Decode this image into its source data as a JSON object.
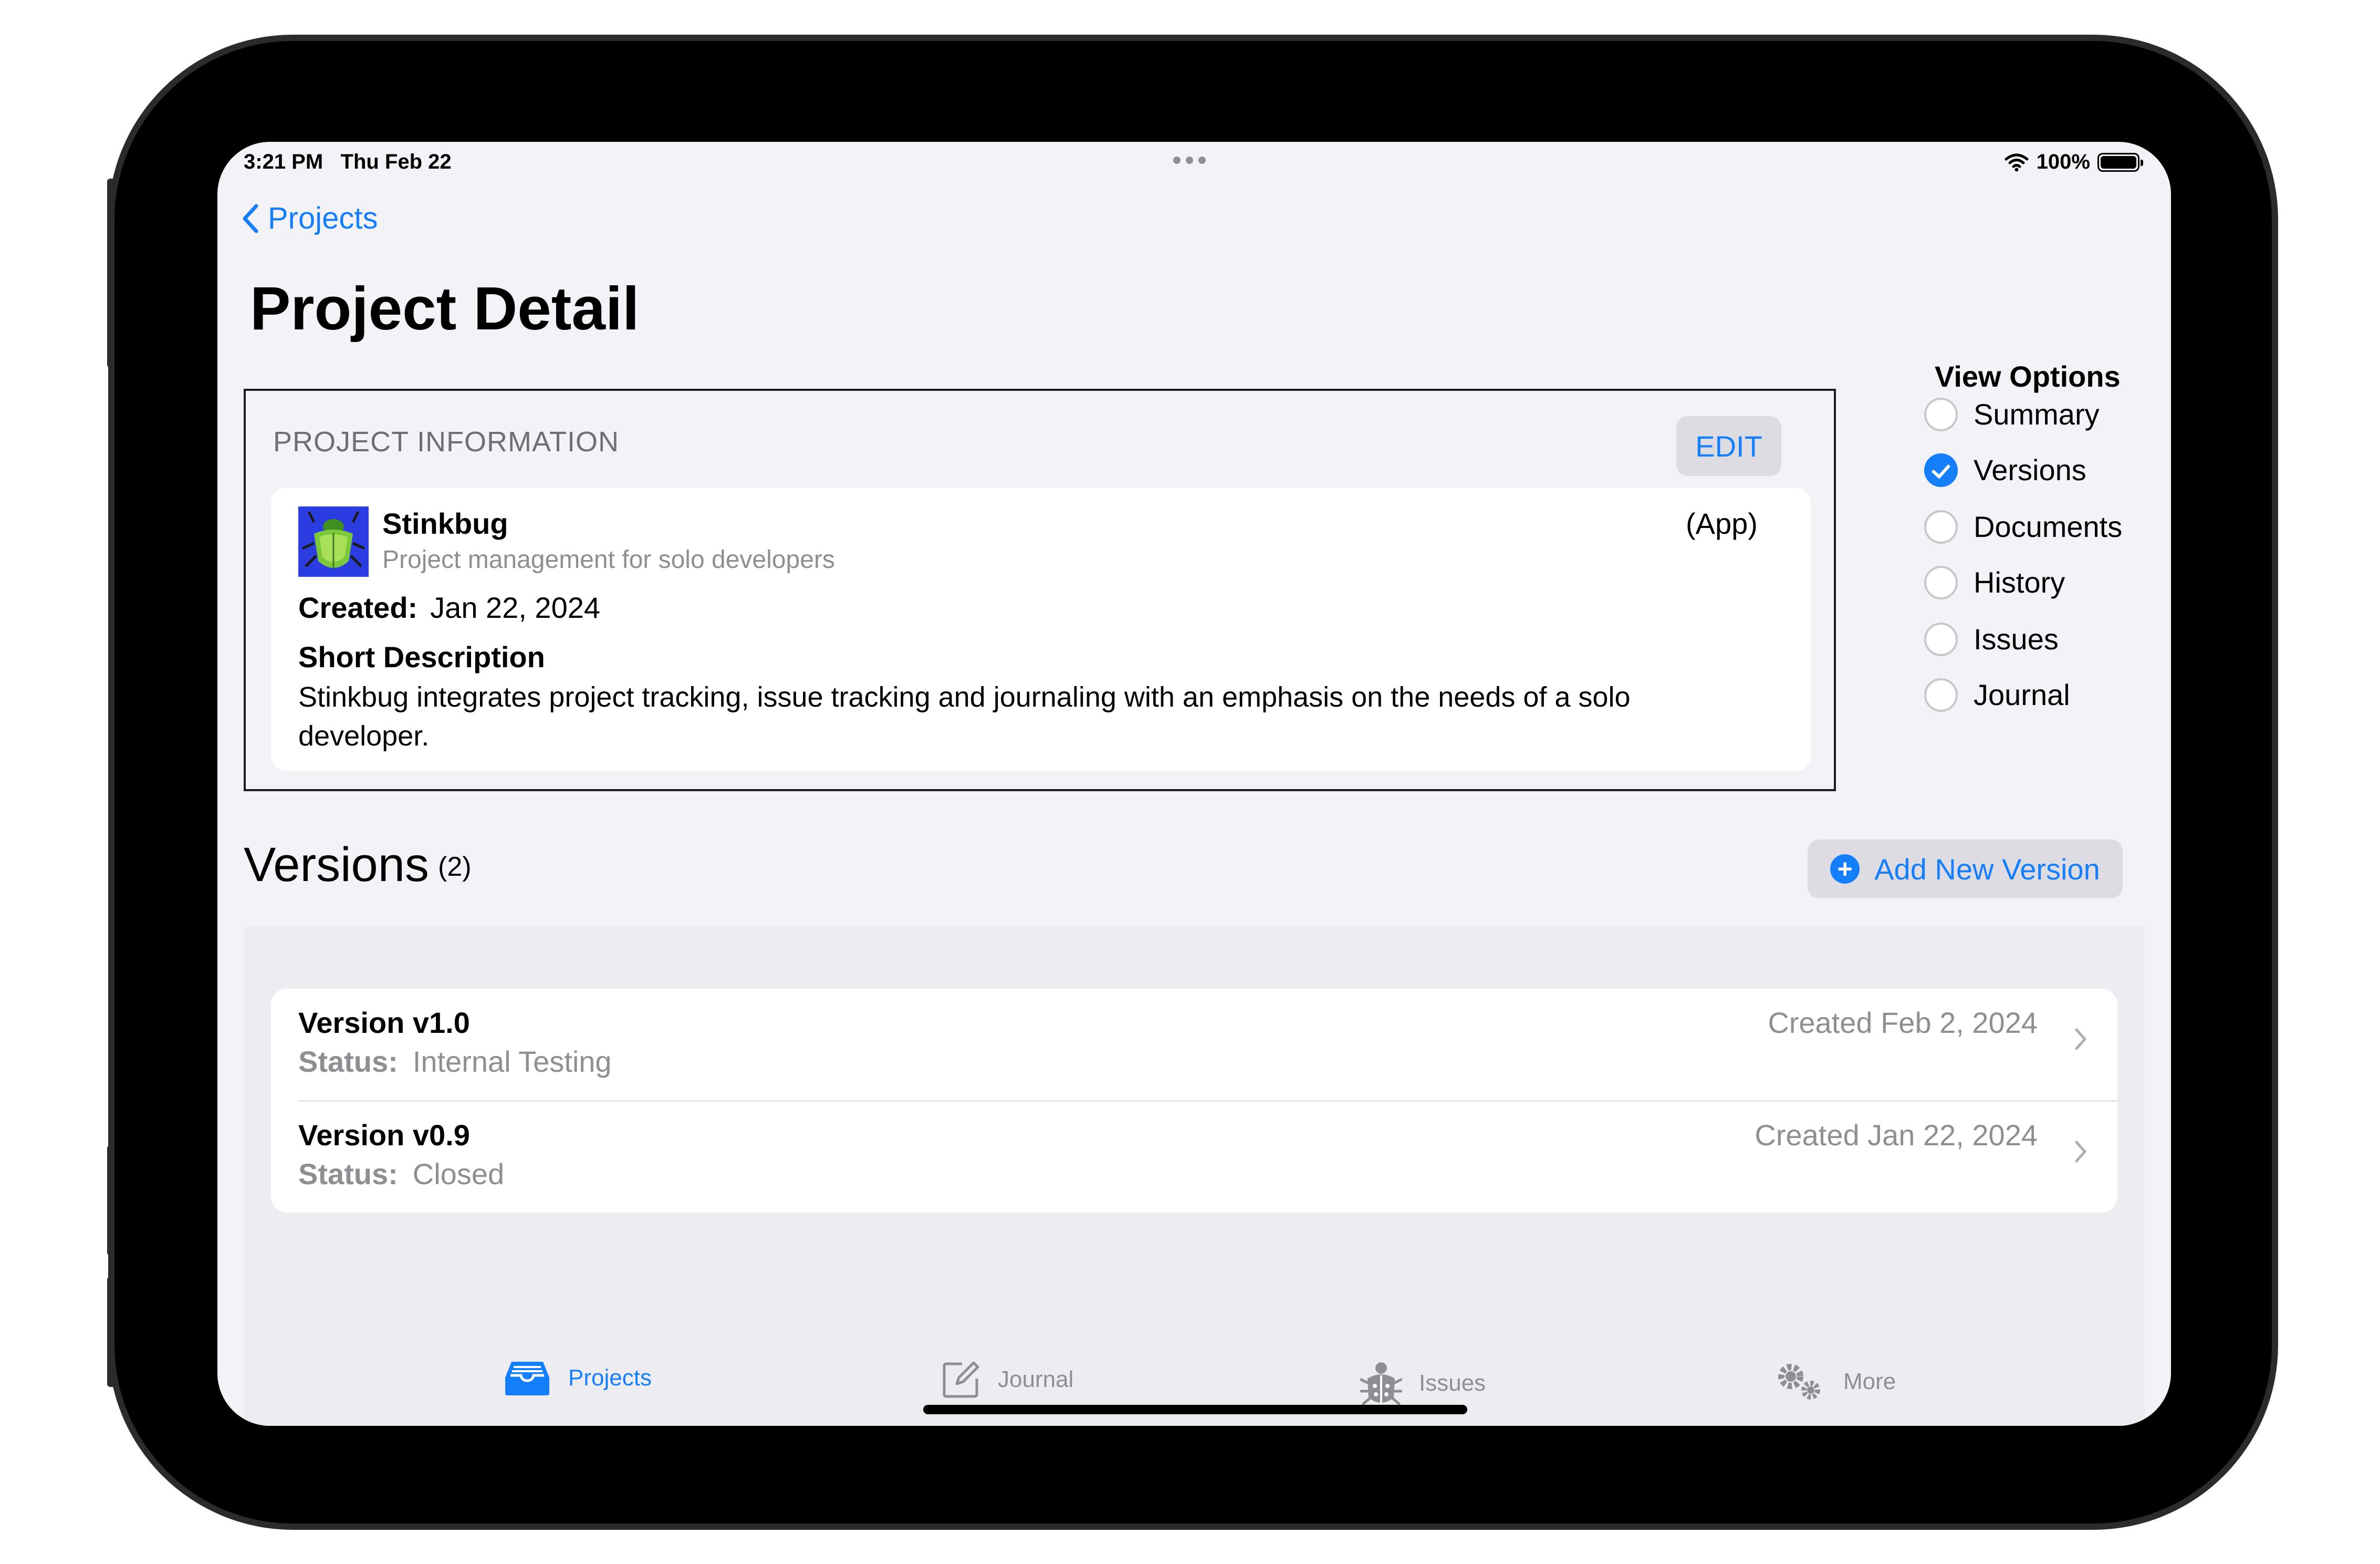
{
  "status_bar": {
    "time": "3:21 PM",
    "date": "Thu Feb 22",
    "battery": "100%"
  },
  "nav": {
    "back_label": "Projects",
    "title": "Project Detail"
  },
  "project_info": {
    "section_header": "PROJECT INFORMATION",
    "edit_label": "EDIT",
    "name": "Stinkbug",
    "subtitle": "Project management for solo developers",
    "type": "(App)",
    "created_label": "Created:",
    "created_value": "Jan 22, 2024",
    "short_desc_title": "Short Description",
    "short_desc": "Stinkbug integrates project tracking, issue tracking and journaling with an emphasis on the needs of a solo developer."
  },
  "view_options": {
    "title": "View Options",
    "items": [
      {
        "label": "Summary",
        "selected": false
      },
      {
        "label": "Versions",
        "selected": true
      },
      {
        "label": "Documents",
        "selected": false
      },
      {
        "label": "History",
        "selected": false
      },
      {
        "label": "Issues",
        "selected": false
      },
      {
        "label": "Journal",
        "selected": false
      }
    ]
  },
  "versions": {
    "heading": "Versions",
    "count": "(2)",
    "add_label": "Add New Version",
    "status_label": "Status:",
    "rows": [
      {
        "title": "Version v1.0",
        "status": "Internal Testing",
        "created": "Created Feb 2, 2024"
      },
      {
        "title": "Version v0.9",
        "status": "Closed",
        "created": "Created Jan 22, 2024"
      }
    ]
  },
  "tabs": [
    {
      "label": "Projects",
      "icon": "tray-icon",
      "active": true
    },
    {
      "label": "Journal",
      "icon": "compose-icon",
      "active": false
    },
    {
      "label": "Issues",
      "icon": "bug-icon",
      "active": false
    },
    {
      "label": "More",
      "icon": "gears-icon",
      "active": false
    }
  ],
  "colors": {
    "accent": "#147efb",
    "secondary_text": "#8e8e93",
    "background": "#f2f2f7"
  }
}
